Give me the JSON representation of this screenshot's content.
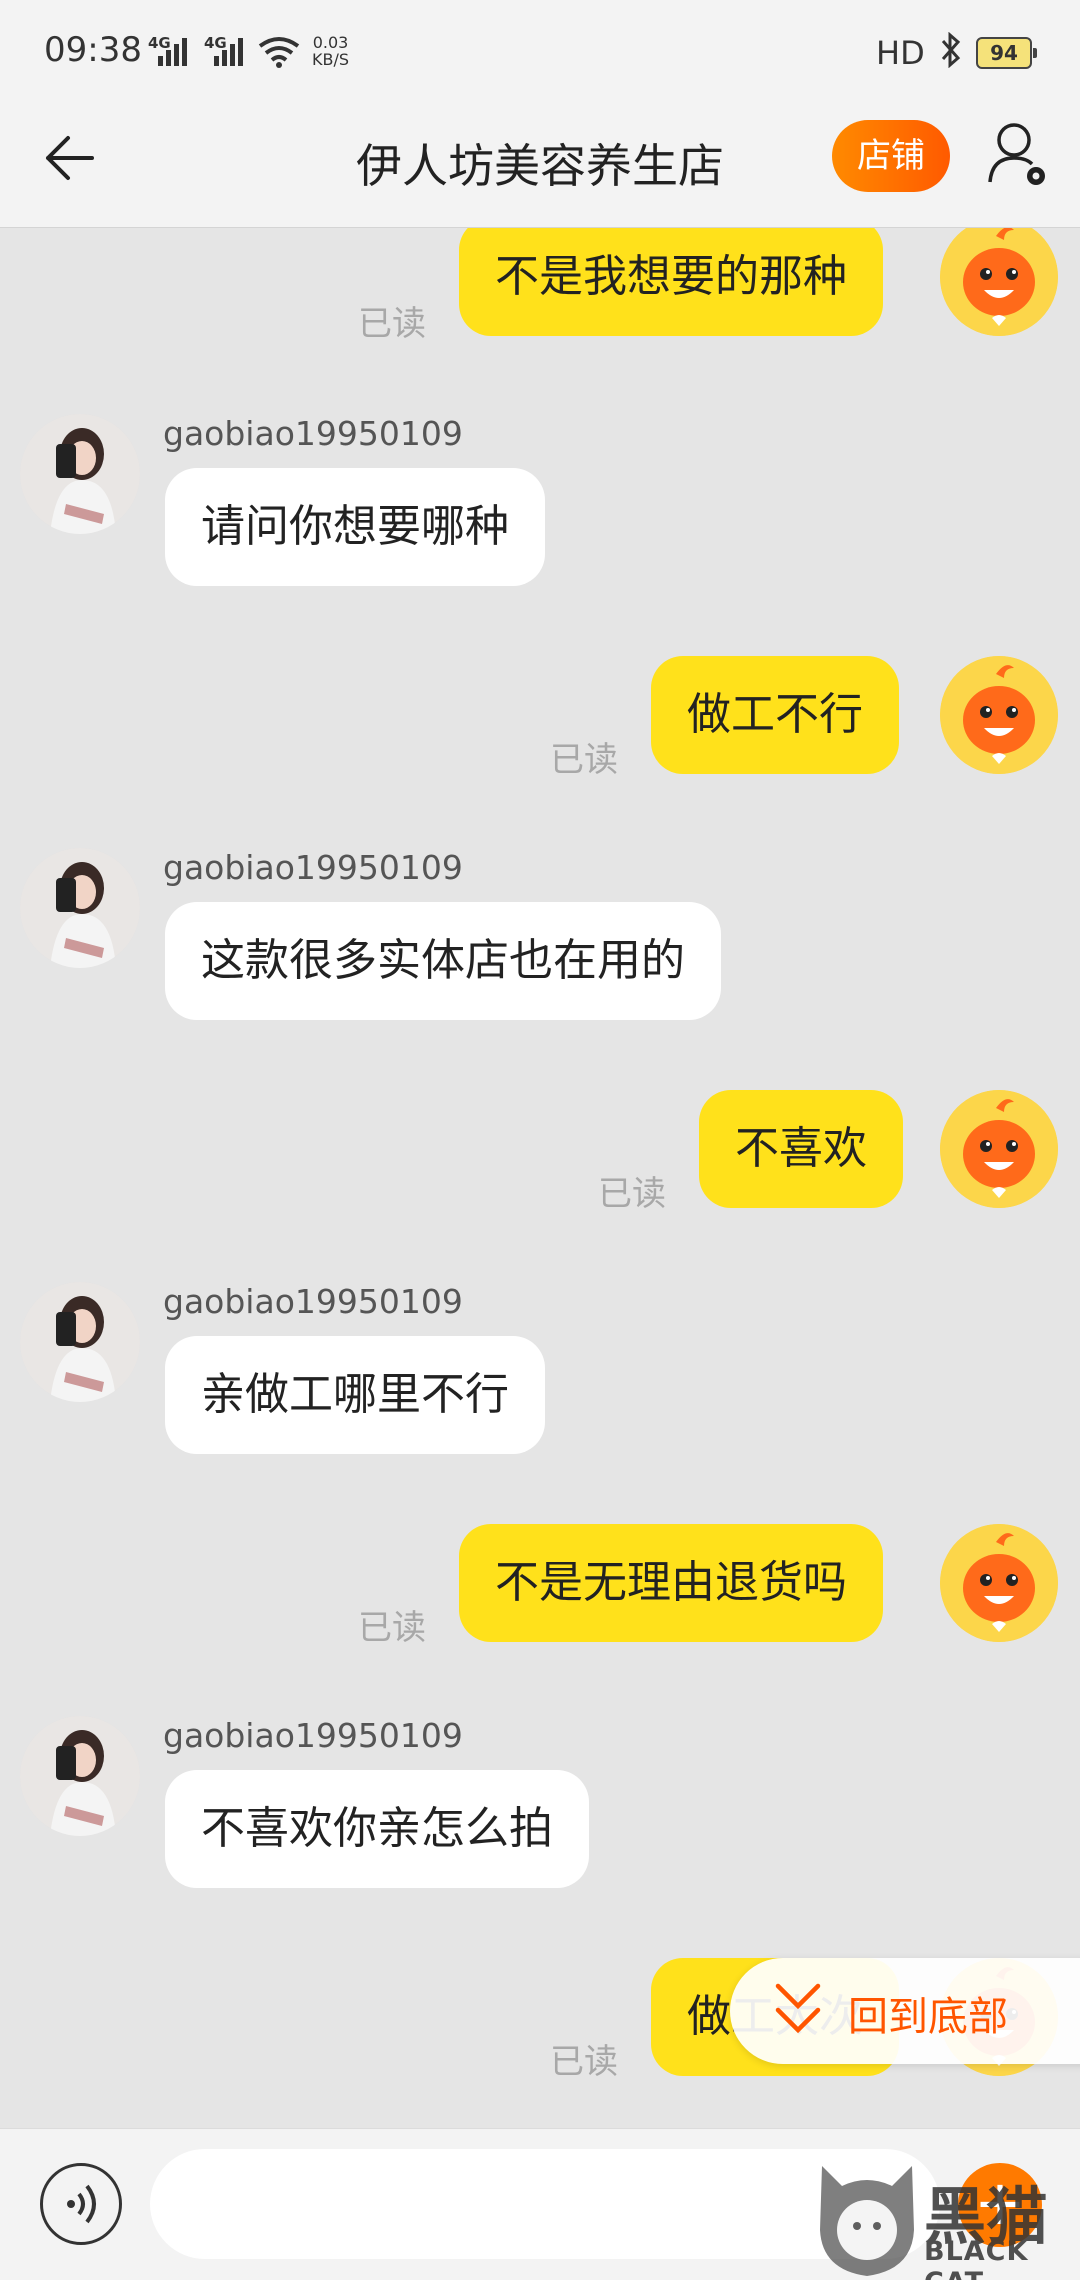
{
  "status_bar": {
    "time": "09:38",
    "network_1": "4G",
    "network_2": "4G",
    "speed_value": "0.03",
    "speed_unit": "KB/S",
    "hd_label": "HD",
    "battery": "94"
  },
  "header": {
    "title": "伊人坊美容养生店",
    "store_button": "店铺"
  },
  "messages": [
    {
      "side": "out",
      "text": "不是我想要的那种",
      "status": "已读"
    },
    {
      "side": "in",
      "user": "gaobiao19950109",
      "text": "请问你想要哪种"
    },
    {
      "side": "out",
      "text": "做工不行",
      "status": "已读"
    },
    {
      "side": "in",
      "user": "gaobiao19950109",
      "text": "这款很多实体店也在用的"
    },
    {
      "side": "out",
      "text": "不喜欢",
      "status": "已读"
    },
    {
      "side": "in",
      "user": "gaobiao19950109",
      "text": "亲做工哪里不行"
    },
    {
      "side": "out",
      "text": "不是无理由退货吗",
      "status": "已读"
    },
    {
      "side": "in",
      "user": "gaobiao19950109",
      "text": "不喜欢你亲怎么拍"
    },
    {
      "side": "out",
      "text": "做工太次",
      "status": "已读"
    }
  ],
  "back_to_bottom": "回到底部",
  "input": {
    "placeholder": ""
  },
  "watermark": {
    "text": "BLACK CAT",
    "glyph": "黑猫"
  },
  "colors": {
    "outgoing_bubble": "#ffe11b",
    "incoming_bubble": "#ffffff",
    "accent": "#ff5a00"
  }
}
